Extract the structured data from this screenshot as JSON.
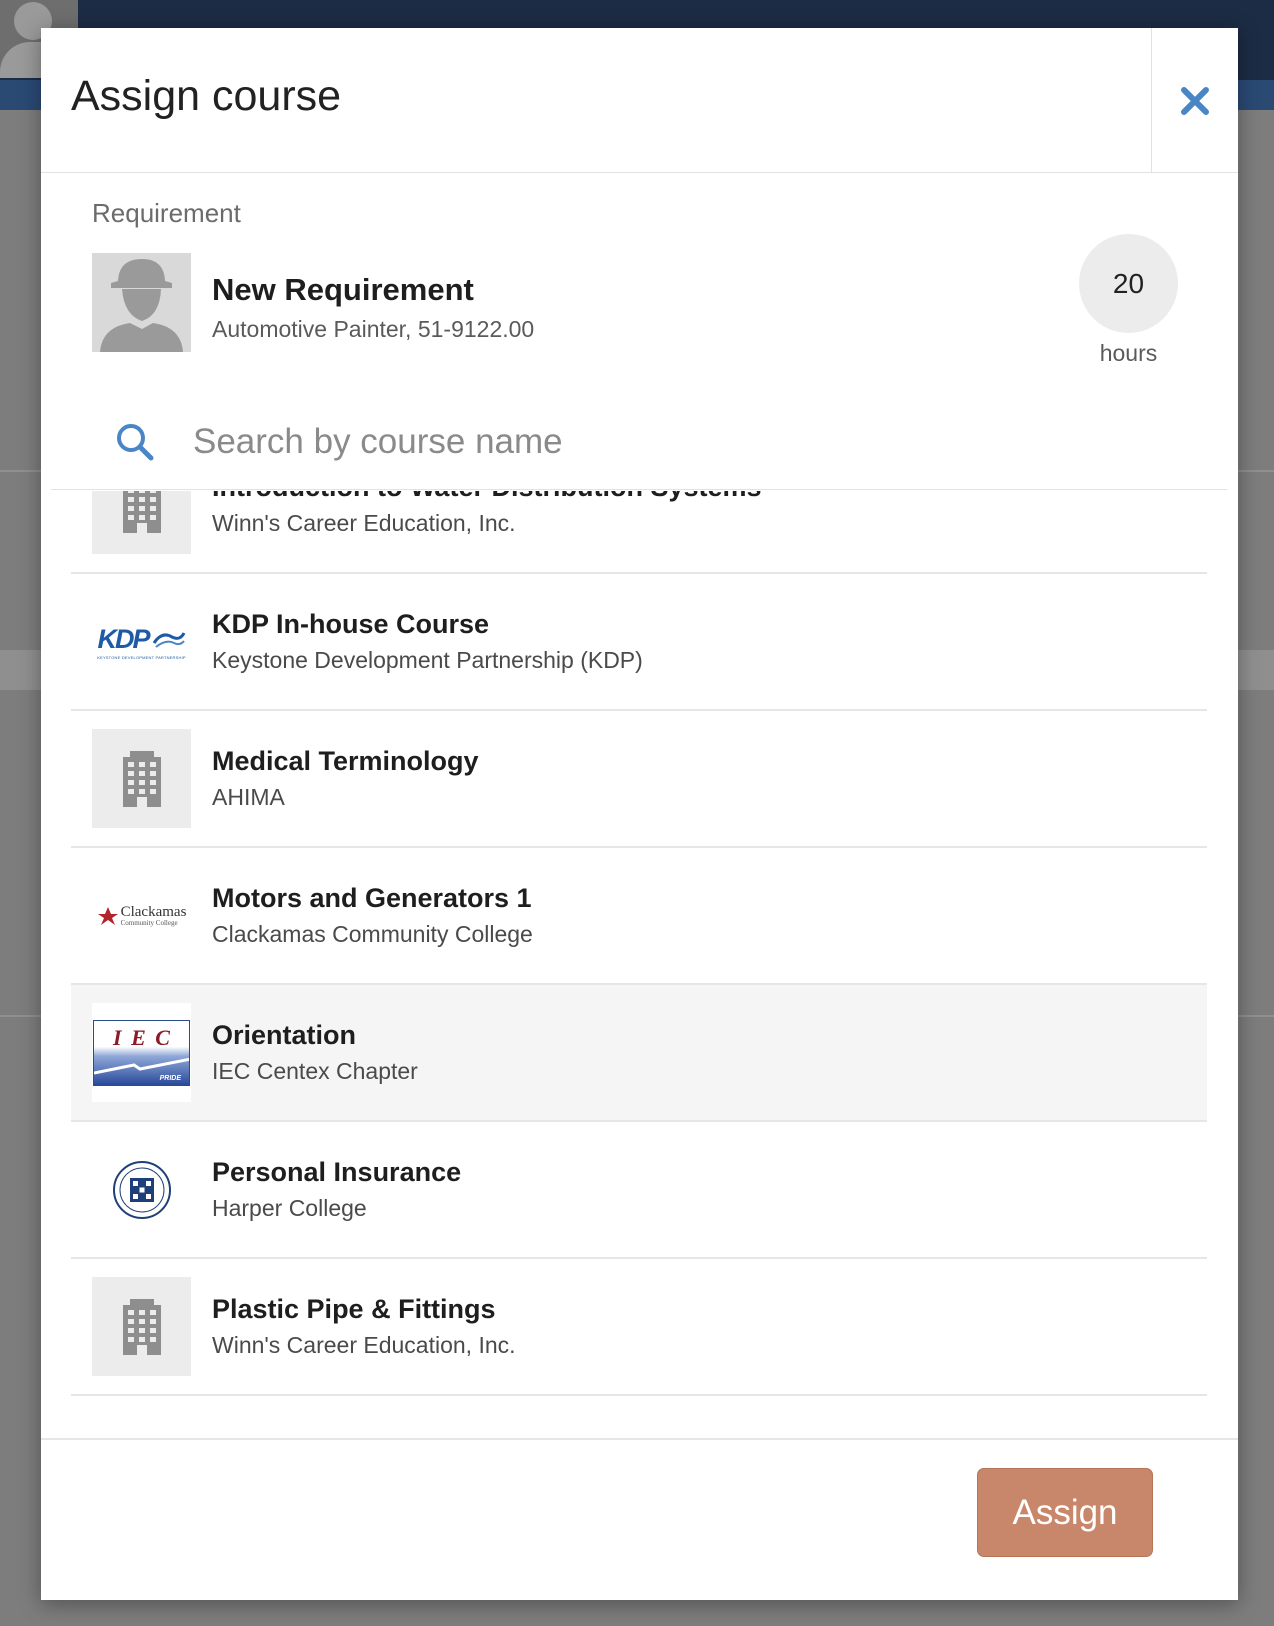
{
  "modal": {
    "title": "Assign course",
    "close_icon": "close-icon"
  },
  "requirement": {
    "section_label": "Requirement",
    "title": "New Requirement",
    "subtitle": "Automotive Painter, 51-9122.00",
    "hours_value": "20",
    "hours_label": "hours",
    "avatar_icon": "worker-silhouette-icon"
  },
  "search": {
    "placeholder": "Search by course name",
    "icon": "search-icon"
  },
  "courses": [
    {
      "name": "Introduction to Water Distribution Systems",
      "org": "Winn's Career Education, Inc.",
      "logo": "building-icon"
    },
    {
      "name": "KDP In-house Course",
      "org": "Keystone Development Partnership (KDP)",
      "logo": "kdp-logo",
      "logo_text": "KDP",
      "logo_caption": "KEYSTONE DEVELOPMENT PARTNERSHIP"
    },
    {
      "name": "Medical Terminology",
      "org": "AHIMA",
      "logo": "building-icon"
    },
    {
      "name": "Motors and Generators 1",
      "org": "Clackamas Community College",
      "logo": "clackamas-logo",
      "logo_text": "Clackamas",
      "logo_caption": "Community College"
    },
    {
      "name": "Orientation",
      "org": "IEC Centex Chapter",
      "logo": "iec-logo",
      "logo_text": "I E C",
      "logo_caption": "PRIDE",
      "highlighted": true
    },
    {
      "name": "Personal Insurance",
      "org": "Harper College",
      "logo": "harper-seal-logo"
    },
    {
      "name": "Plastic Pipe & Fittings",
      "org": "Winn's Career Education, Inc.",
      "logo": "building-icon"
    }
  ],
  "footer": {
    "assign_label": "Assign"
  },
  "colors": {
    "accent_blue": "#4a86c5",
    "assign_button": "#c8876b"
  }
}
